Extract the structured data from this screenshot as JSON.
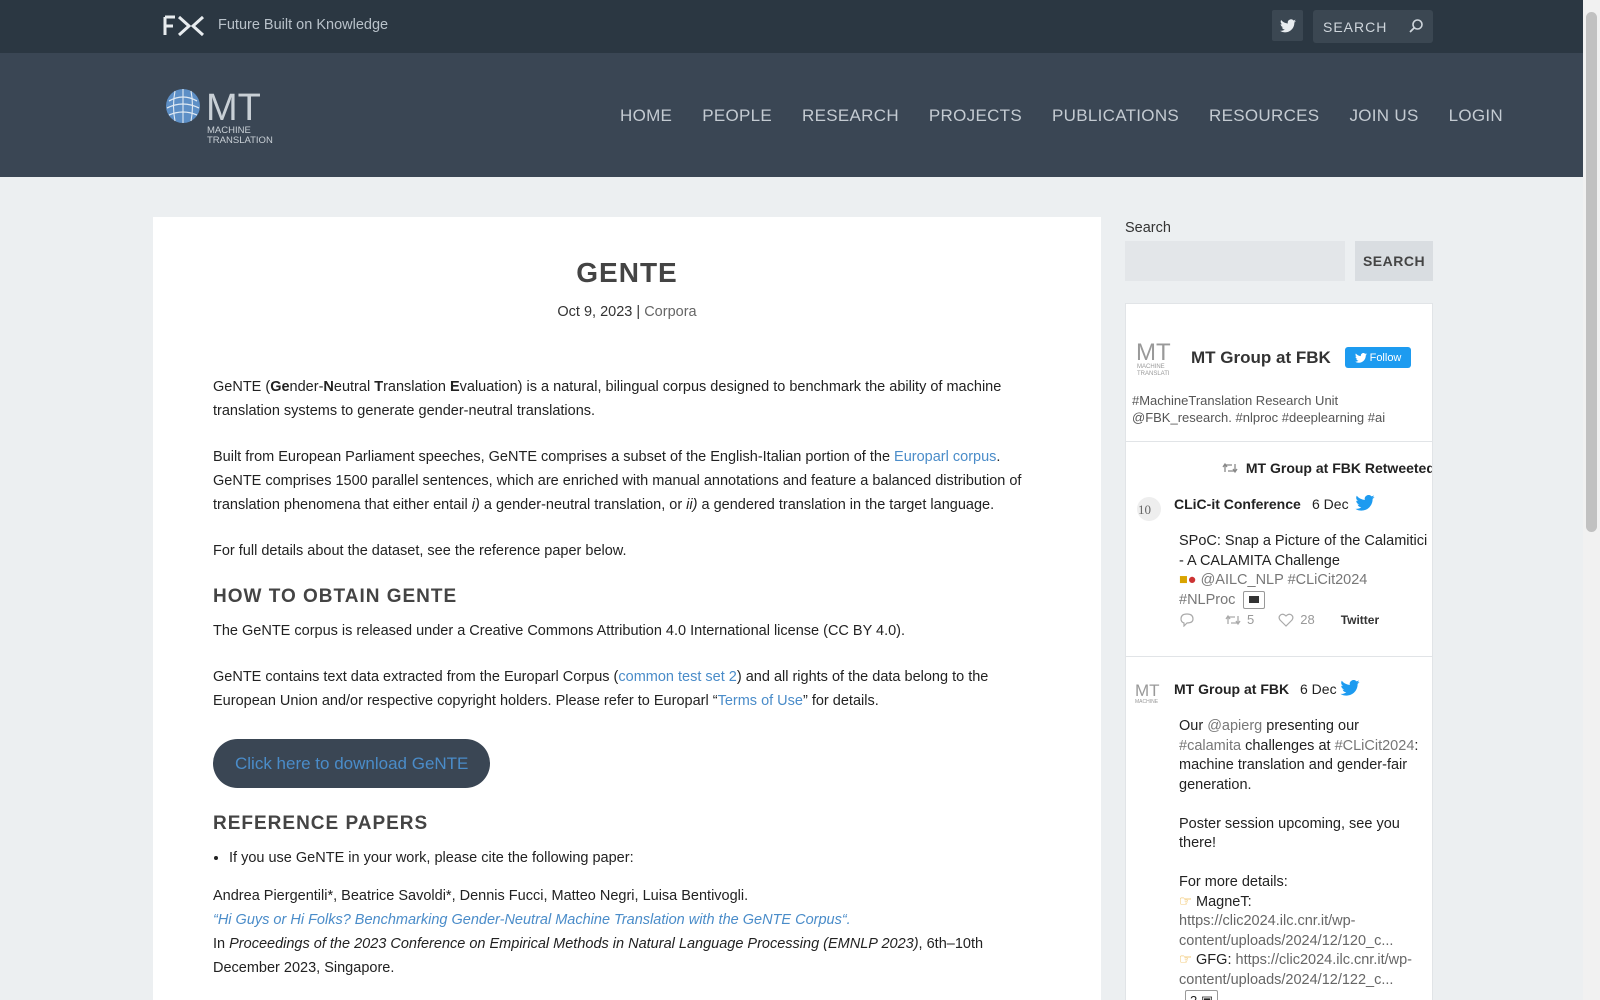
{
  "topbar": {
    "tagline": "Future Built on Knowledge",
    "search_placeholder": "SEARCH"
  },
  "logo": {
    "letters": "MT",
    "line1": "MACHINE",
    "line2": "TRANSLATION"
  },
  "nav": [
    "HOME",
    "PEOPLE",
    "RESEARCH",
    "PROJECTS",
    "PUBLICATIONS",
    "RESOURCES",
    "JOIN US",
    "LOGIN"
  ],
  "post": {
    "title": "GENTE",
    "date": "Oct 9, 2023",
    "meta_sep": "|",
    "category": "Corpora",
    "intro_pre": "GeNTE (",
    "intro_ge": "Ge",
    "intro_nder": "nder-",
    "intro_n": "N",
    "intro_eutral": "eutral ",
    "intro_t": "T",
    "intro_ranslation": "ranslation ",
    "intro_e": "E",
    "intro_rest": "valuation) is a natural, bilingual corpus designed to benchmark the ability of machine translation systems to generate gender-neutral translations.",
    "p2_pre": "Built from European Parliament speeches, GeNTE comprises a subset of the English-Italian portion of the ",
    "p2_link": "Europarl corpus",
    "p2_mid": ". GeNTE comprises 1500 parallel sentences, which are enriched with manual annotations and feature a balanced distribution of translation phenomena that either entail ",
    "p2_i": "i)",
    "p2_mid2": " a gender-neutral translation, or ",
    "p2_ii": "ii)",
    "p2_end": " a gendered translation in the target language.",
    "p3": "For full details about the dataset, see the reference paper below.",
    "h_obtain": "HOW TO OBTAIN GENTE",
    "p4": "The GeNTE corpus is released under a Creative Commons Attribution 4.0 International license (CC BY 4.0).",
    "p5_pre": "GeNTE contains text data extracted from the Europarl Corpus (",
    "p5_link": "common test set 2",
    "p5_mid": ") and all rights of the data belong to the European Union and/or respective copyright holders. Please refer to Europarl “",
    "p5_link2": "Terms of Use",
    "p5_end": "” for details.",
    "download_pre": "Click here to download ",
    "download_link": "GeNTE",
    "h_ref": "REFERENCE PAPERS",
    "bullet": "If you use GeNTE in your work, please cite the following paper:",
    "authors": "Andrea Piergentili*, Beatrice Savoldi*, Dennis Fucci, Matteo Negri, Luisa Bentivogli.",
    "cite_title": "“Hi Guys or Hi Folks? Benchmarking Gender-Neutral Machine Translation with the GeNTE Corpus“.",
    "cite_in": "In ",
    "cite_venue": "Proceedings of the 2023 Conference on Empirical Methods in Natural Language Processing (EMNLP 2023)",
    "cite_end": ", 6th–10th December 2023, Singapore."
  },
  "sidebar": {
    "search_label": "Search",
    "search_button": "SEARCH",
    "twitter": {
      "account": "MT Group at FBK",
      "follow": "Follow",
      "bio": "#MachineTranslation Research Unit @FBK_research. #nlproc #deeplearning #ai",
      "retweeted": "MT Group at FBK Retweeted",
      "t1_author": "CLiC-it Conference",
      "t1_date": "6 Dec",
      "t1_text": "SPoC: Snap a Picture of the Calamitici - A CALAMITA Challenge",
      "t1_mention": "@AILC_NLP",
      "t1_tag1": "#CLiCit2024",
      "t1_tag2": "#NLProc",
      "t1_retweets": "5",
      "t1_likes": "28",
      "t1_source": "Twitter",
      "t2_author": "MT Group at FBK",
      "t2_date": "6 Dec",
      "t2_our": "Our ",
      "t2_mention": "@apierg",
      "t2_presenting": " presenting our",
      "t2_tag1": "#calamita",
      "t2_challenges": " challenges at ",
      "t2_tag2": "#CLiCit2024",
      "t2_rest": ": machine translation and gender-fair generation.",
      "t2_poster": "Poster session upcoming, see you there!",
      "t2_more": "For more details:",
      "t2_magnet": " MagneT:",
      "t2_url1": "https://clic2024.ilc.cnr.it/wp-content/uploads/2024/12/120_c...",
      "t2_gfg": " GFG: ",
      "t2_url2": "https://clic2024.ilc.cnr.it/wp-content/uploads/2024/12/122_c...",
      "t2_images": "2"
    }
  },
  "colors": {
    "topbar": "#2b3742",
    "header": "#3a4654",
    "link": "#4a8cc9",
    "twitter": "#1d9bf0"
  }
}
